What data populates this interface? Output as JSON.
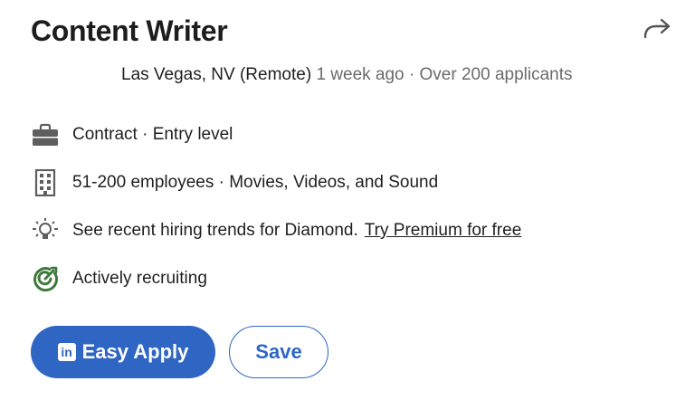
{
  "job": {
    "title": "Content Writer",
    "location": "Las Vegas, NV (Remote)",
    "posted": "1 week ago",
    "separator": "·",
    "applicants": "Over 200 applicants"
  },
  "insights": [
    {
      "icon": "briefcase-icon",
      "text": "Contract · Entry level"
    },
    {
      "icon": "building-icon",
      "text": "51-200 employees · Movies, Videos, and Sound"
    },
    {
      "icon": "lightbulb-icon",
      "text": "See recent hiring trends for Diamond.",
      "link": "Try Premium for free"
    },
    {
      "icon": "target-icon",
      "text": "Actively recruiting"
    }
  ],
  "actions": {
    "apply_logo": "in",
    "apply_label": "Easy Apply",
    "save_label": "Save"
  },
  "colors": {
    "primary": "#2f66c3",
    "recruiting_green": "#3d7a3a",
    "icon_gray": "#5e5e5e",
    "muted_text": "#6b6b6b"
  }
}
